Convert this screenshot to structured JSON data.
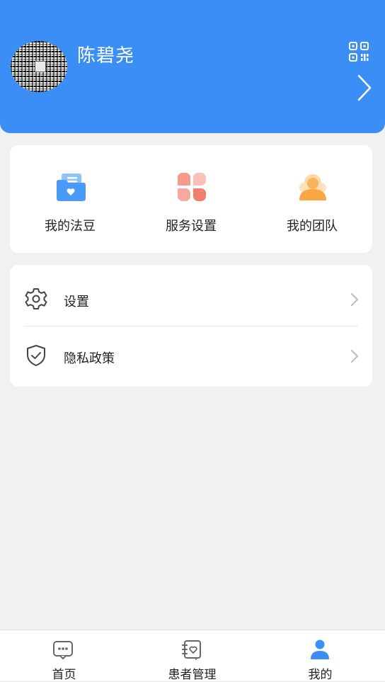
{
  "profile": {
    "name": "陈碧尧"
  },
  "quick_actions": [
    {
      "label": "我的法豆",
      "icon": "folder-heart-icon"
    },
    {
      "label": "服务设置",
      "icon": "petals-icon"
    },
    {
      "label": "我的团队",
      "icon": "team-icon"
    }
  ],
  "menu": [
    {
      "label": "设置",
      "icon": "gear-icon"
    },
    {
      "label": "隐私政策",
      "icon": "shield-check-icon"
    }
  ],
  "tabbar": [
    {
      "label": "首页",
      "icon": "chat-bubble-icon"
    },
    {
      "label": "患者管理",
      "icon": "notebook-heart-icon"
    },
    {
      "label": "我的",
      "icon": "person-icon",
      "active": true
    }
  ],
  "colors": {
    "header_blue": "#3a8ef6",
    "active_blue": "#3a8ef6",
    "page_bg": "#f1f1f1"
  }
}
